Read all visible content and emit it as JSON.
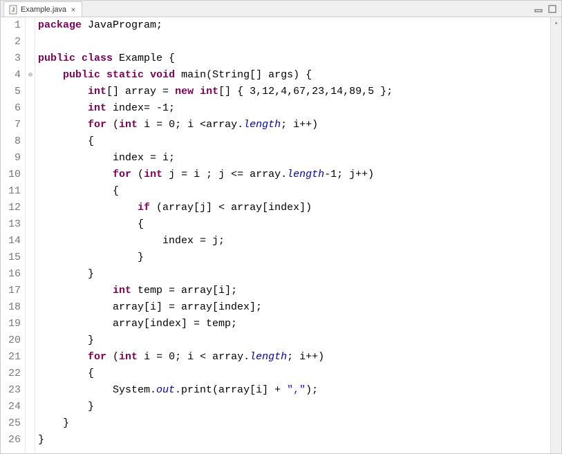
{
  "tab": {
    "filename": "Example.java",
    "close_glyph": "×"
  },
  "toolbar": {
    "minimize_title": "Minimize",
    "maximize_title": "Maximize"
  },
  "gutter": {
    "marker_line": 4,
    "marker_glyph": "⊖"
  },
  "code": {
    "lines": [
      [
        [
          "kw",
          "package"
        ],
        [
          "",
          " JavaProgram;"
        ]
      ],
      [],
      [
        [
          "kw",
          "public"
        ],
        [
          "",
          " "
        ],
        [
          "kw",
          "class"
        ],
        [
          "",
          " Example {"
        ]
      ],
      [
        [
          "",
          "    "
        ],
        [
          "kw",
          "public"
        ],
        [
          "",
          " "
        ],
        [
          "kw",
          "static"
        ],
        [
          "",
          " "
        ],
        [
          "kw",
          "void"
        ],
        [
          "",
          " main(String[] args) {"
        ]
      ],
      [
        [
          "",
          "        "
        ],
        [
          "kw",
          "int"
        ],
        [
          "",
          "[] array = "
        ],
        [
          "kw",
          "new"
        ],
        [
          "",
          " "
        ],
        [
          "kw",
          "int"
        ],
        [
          "",
          "[] { 3,12,4,67,23,14,89,5 };"
        ]
      ],
      [
        [
          "",
          "        "
        ],
        [
          "kw",
          "int"
        ],
        [
          "",
          " index= -1;"
        ]
      ],
      [
        [
          "",
          "        "
        ],
        [
          "kw",
          "for"
        ],
        [
          "",
          " ("
        ],
        [
          "kw",
          "int"
        ],
        [
          "",
          " i = 0; i <array."
        ],
        [
          "fld",
          "length"
        ],
        [
          "",
          "; i++)"
        ]
      ],
      [
        [
          "",
          "        {"
        ]
      ],
      [
        [
          "",
          "            index = i;"
        ]
      ],
      [
        [
          "",
          "            "
        ],
        [
          "kw",
          "for"
        ],
        [
          "",
          " ("
        ],
        [
          "kw",
          "int"
        ],
        [
          "",
          " j = i ; j <= array."
        ],
        [
          "fld",
          "length"
        ],
        [
          "",
          "-1; j++)"
        ]
      ],
      [
        [
          "",
          "            {"
        ]
      ],
      [
        [
          "",
          "                "
        ],
        [
          "kw",
          "if"
        ],
        [
          "",
          " (array[j] < array[index])"
        ]
      ],
      [
        [
          "",
          "                {"
        ]
      ],
      [
        [
          "",
          "                    index = j;"
        ]
      ],
      [
        [
          "",
          "                }"
        ]
      ],
      [
        [
          "",
          "        }"
        ]
      ],
      [
        [
          "",
          "            "
        ],
        [
          "kw",
          "int"
        ],
        [
          "",
          " temp = array[i];"
        ]
      ],
      [
        [
          "",
          "            array[i] = array[index];"
        ]
      ],
      [
        [
          "",
          "            array[index] = temp;"
        ]
      ],
      [
        [
          "",
          "        }"
        ]
      ],
      [
        [
          "",
          "        "
        ],
        [
          "kw",
          "for"
        ],
        [
          "",
          " ("
        ],
        [
          "kw",
          "int"
        ],
        [
          "",
          " i = 0; i < array."
        ],
        [
          "fld",
          "length"
        ],
        [
          "",
          "; i++)"
        ]
      ],
      [
        [
          "",
          "        {"
        ]
      ],
      [
        [
          "",
          "            System."
        ],
        [
          "fld",
          "out"
        ],
        [
          "",
          ".print(array[i] + "
        ],
        [
          "str",
          "\",\""
        ],
        [
          "",
          ");"
        ]
      ],
      [
        [
          "",
          "        }"
        ]
      ],
      [
        [
          "",
          "    }"
        ]
      ],
      [
        [
          "",
          "}"
        ]
      ]
    ]
  }
}
